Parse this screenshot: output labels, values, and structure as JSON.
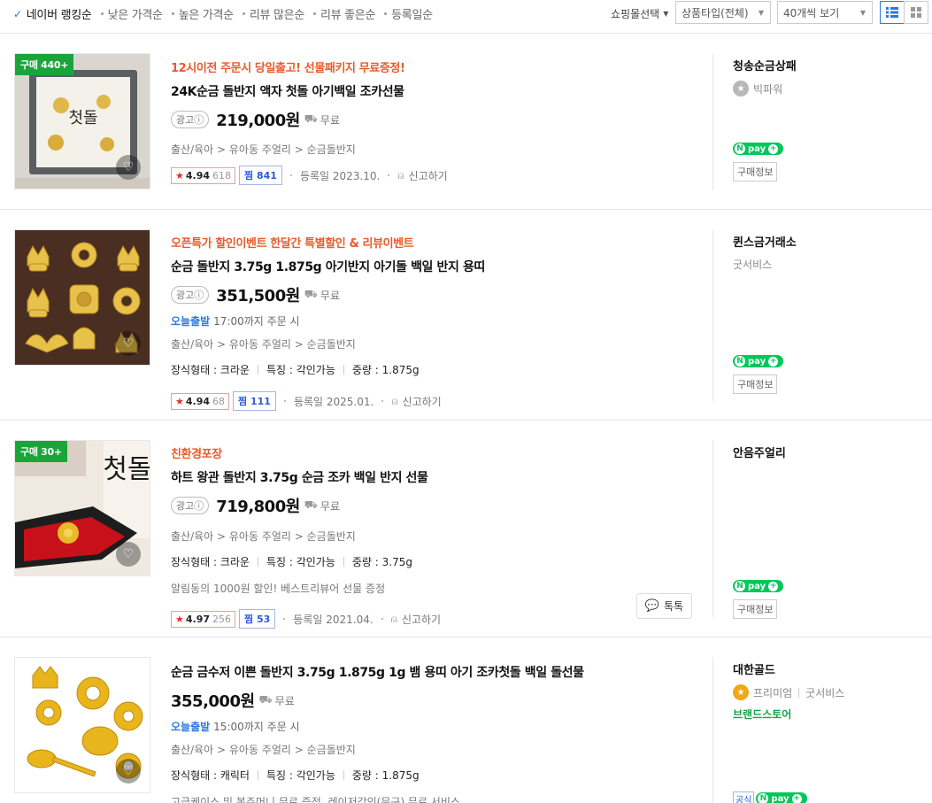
{
  "sort": {
    "items": [
      {
        "label": "네이버 랭킹순",
        "active": true
      },
      {
        "label": "낮은 가격순",
        "active": false
      },
      {
        "label": "높은 가격순",
        "active": false
      },
      {
        "label": "리뷰 많은순",
        "active": false
      },
      {
        "label": "리뷰 좋은순",
        "active": false
      },
      {
        "label": "등록일순",
        "active": false
      }
    ],
    "mall_select": "쇼핑몰선택",
    "product_type": "상품타입(전체)",
    "page_size": "40개씩 보기"
  },
  "products": [
    {
      "badge": "구매 440+",
      "promo": "12시이전 주문시 당일출고! 선물패키지 무료증정!",
      "title": "24K순금 돌반지 액자 첫돌 아기백일 조카선물",
      "ad": "광고ⓘ",
      "price": "219,000원",
      "shipping": "무료",
      "category": "출산/육아 > 유아동 주얼리 > 순금돌반지",
      "rating": "4.94",
      "reviews": "618",
      "zzim_label": "찜",
      "zzim": "841",
      "registered": "등록일 2023.10.",
      "report": "신고하기",
      "seller": "청송순금상패",
      "grade": "빅파워",
      "buyinfo": "구매정보"
    },
    {
      "promo": "오픈특가 할인이벤트 한달간 특별할인 & 리뷰이벤트",
      "title": "순금 돌반지 3.75g 1.875g 아기반지 아기돌 백일 반지 용띠",
      "ad": "광고ⓘ",
      "price": "351,500원",
      "shipping": "무료",
      "today_label": "오늘출발",
      "today_text": "17:00까지 주문 시",
      "category": "출산/육아 > 유아동 주얼리 > 순금돌반지",
      "attr1": "장식형태 : 크라운",
      "attr2": "특징 : 각인가능",
      "attr3": "중량 : 1.875g",
      "rating": "4.94",
      "reviews": "68",
      "zzim_label": "찜",
      "zzim": "111",
      "registered": "등록일 2025.01.",
      "report": "신고하기",
      "seller": "퀸스금거래소",
      "grade": "굿서비스",
      "buyinfo": "구매정보"
    },
    {
      "badge": "구매 30+",
      "promo": "친환경포장",
      "title": "하트 왕관 돌반지 3.75g 순금 조카 백일 반지 선물",
      "ad": "광고ⓘ",
      "price": "719,800원",
      "shipping": "무료",
      "category": "출산/육아 > 유아동 주얼리 > 순금돌반지",
      "attr1": "장식형태 : 크라운",
      "attr2": "특징 : 각인가능",
      "attr3": "중량 : 3.75g",
      "desc": "알림동의 1000원 할인! 베스트리뷰어 선물 증정",
      "rating": "4.97",
      "reviews": "256",
      "zzim_label": "찜",
      "zzim": "53",
      "registered": "등록일 2021.04.",
      "report": "신고하기",
      "talk": "톡톡",
      "seller": "안음주얼리",
      "buyinfo": "구매정보"
    },
    {
      "title": "순금 금수저 이쁜 돌반지 3.75g 1.875g 1g 뱀 용띠 아기 조카첫돌 백일 돌선물",
      "price": "355,000원",
      "shipping": "무료",
      "today_label": "오늘출발",
      "today_text": "15:00까지 주문 시",
      "category": "출산/육아 > 유아동 주얼리 > 순금돌반지",
      "attr1": "장식형태 : 캐릭터",
      "attr2": "특징 : 각인가능",
      "attr3": "중량 : 1.875g",
      "desc": "고급케이스 및 복주머니 무료 증정, 레이저각인(문구) 무료 서비스",
      "seller": "대한골드",
      "grade1": "프리미엄",
      "grade2": "굿서비스",
      "brand_store": "브랜드스토어",
      "official": "공식"
    }
  ],
  "thumb_text": {
    "p1": "첫돌",
    "p3": "첫돌"
  },
  "npay": {
    "n": "N",
    "label": "pay",
    "plus": "+"
  }
}
